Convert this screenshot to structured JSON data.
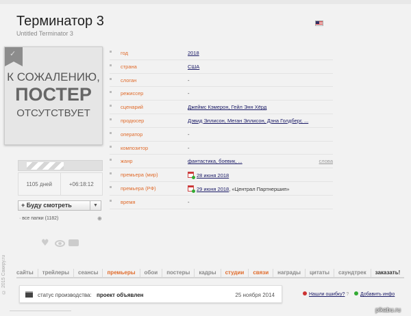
{
  "header": {
    "title": "Терминатор 3",
    "original_title": "Untitled Terminator 3",
    "flag_icon": "us-flag-icon"
  },
  "poster": {
    "line1": "К СОЖАЛЕНИЮ,",
    "line2": "ПОСТЕР",
    "line3": "ОТСУТСТВУЕТ"
  },
  "countdown": {
    "days": "1105 дней",
    "time": "+06:18:12"
  },
  "watchlist": {
    "button_label": "+ Буду смотреть",
    "folders_label": "все папки (1182)"
  },
  "info_rows": [
    {
      "label": "год",
      "value": "2018",
      "linked": true
    },
    {
      "label": "страна",
      "value": "США",
      "linked": true
    },
    {
      "label": "слоган",
      "value": "-",
      "linked": false
    },
    {
      "label": "режиссер",
      "value": "-",
      "linked": false
    },
    {
      "label": "сценарий",
      "value": "Джеймс Кэмерон, Гейл Энн Хёрд",
      "linked": true
    },
    {
      "label": "продюсер",
      "value": "Дэвид Эллисон, Меган Эллисон, Дэна Голдберг, ...",
      "linked": true
    },
    {
      "label": "оператор",
      "value": "-",
      "linked": false
    },
    {
      "label": "композитор",
      "value": "-",
      "linked": false
    },
    {
      "label": "жанр",
      "value": "фантастика, боевик, ...",
      "linked": true,
      "extra": "слова"
    },
    {
      "label": "премьера (мир)",
      "value": "28 июня 2018",
      "linked": true,
      "calendar": true
    },
    {
      "label": "премьера (РФ)",
      "value": "29 июня 2018",
      "value_suffix": ", «Централ Партнершип»",
      "linked": true,
      "calendar": true
    },
    {
      "label": "время",
      "value": "-",
      "linked": false
    }
  ],
  "tabs": [
    "сайты",
    "трейлеры",
    "сеансы",
    "премьеры",
    "обои",
    "постеры",
    "кадры",
    "студии",
    "связи",
    "награды",
    "цитаты",
    "саундтрек",
    "заказать!"
  ],
  "production": {
    "label": "статус производства:",
    "value": "проект объявлен",
    "date": "25 ноября 2014"
  },
  "actions": {
    "error_link": "Нашли ошибку?",
    "add_info": "Добавить инфо"
  },
  "watermark": "pikabu.ru",
  "side_text": "© 2015 Сакиру.ru",
  "colors": {
    "accent": "#e06b2b",
    "link": "#1a1a66",
    "background": "#f2f2f2"
  }
}
